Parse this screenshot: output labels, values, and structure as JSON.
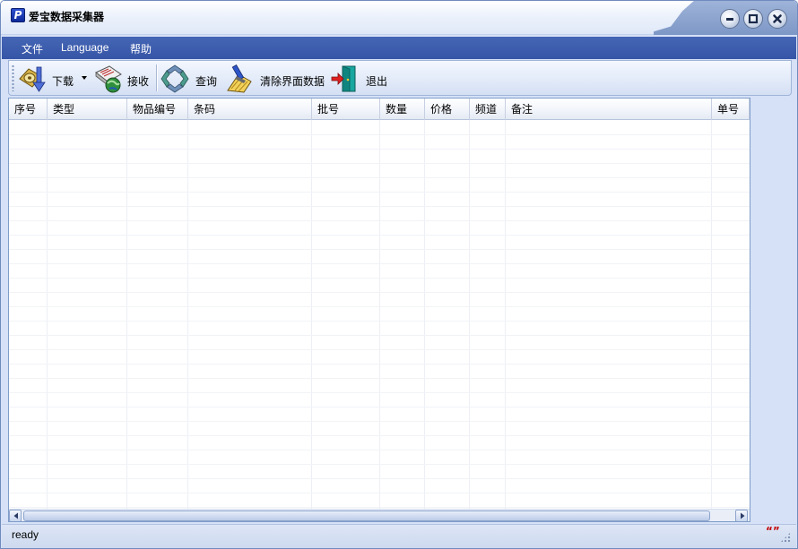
{
  "window": {
    "title": "爱宝数据采集器",
    "app_icon_letter": "P"
  },
  "menu": {
    "items": [
      {
        "label": "文件"
      },
      {
        "label": "Language"
      },
      {
        "label": "帮助"
      }
    ]
  },
  "toolbar": {
    "download_label": "下载",
    "receive_label": "接收",
    "query_label": "查询",
    "clear_label": "清除界面数据",
    "exit_label": "退出"
  },
  "table": {
    "columns": [
      "序号",
      "类型",
      "物品编号",
      "条码",
      "批号",
      "数量",
      "价格",
      "频道",
      "备注",
      "单号"
    ],
    "rows": []
  },
  "status": {
    "text": "ready",
    "indicator": "“”"
  },
  "colors": {
    "menubar": "#3a5aab",
    "window_bg": "#d6e1f7",
    "title_accent": "#8aa2cf"
  }
}
